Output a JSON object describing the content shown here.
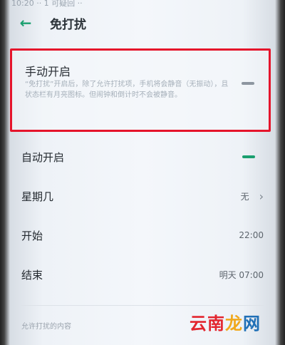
{
  "status_bar": {
    "text": "10:20 ·· 1 可疑回 ··"
  },
  "header": {
    "back_icon": "arrow-left-icon",
    "title": "免打扰"
  },
  "manual_card": {
    "title": "手动开启",
    "description": "“免打扰”开启后，除了允许打扰项，手机将会静音（无振动），且状态栏有月亮图标。但闹钟和倒计时不会被静音。",
    "toggle_state": "off"
  },
  "rows": [
    {
      "label": "自动开启",
      "toggle_state": "on"
    },
    {
      "label": "星期几",
      "value": "无",
      "chevron": "chevron-right-icon"
    },
    {
      "label": "开始",
      "value": "22:00"
    },
    {
      "label": "结束",
      "value": "明天 07:00"
    }
  ],
  "section": {
    "label": "允许打扰的内容"
  },
  "watermark": {
    "text": "云南龙网"
  },
  "colors": {
    "accent": "#1a9f6f",
    "highlight_border": "#e5142b"
  }
}
